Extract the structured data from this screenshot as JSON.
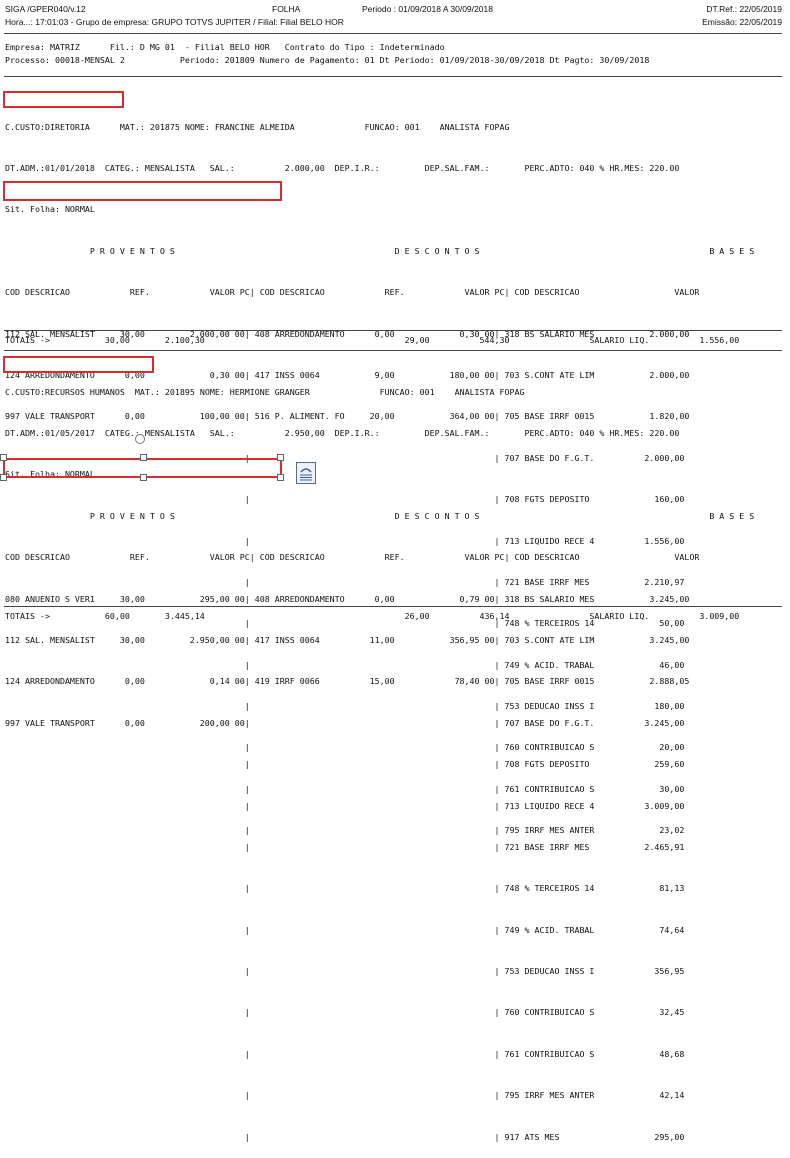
{
  "header": {
    "program": "SIGA /GPER040/v.12",
    "title": "FOLHA",
    "period": "Periodo : 01/09/2018 A 30/09/2018",
    "dt_ref": "DT.Ref.: 22/05/2019",
    "hora": "Hora...: 17:01:03 - Grupo de empresa: GRUPO TOTVS JUPITER / Filial: Filial BELO HOR",
    "emissao": "Emissão: 22/05/2019"
  },
  "company": {
    "line1": "Empresa: MATRIZ      Fil.: D MG 01  - Filial BELO HOR   Contrato do Tipo : Indeterminado",
    "line2": "Processo: 00018-MENSAL 2           Periodo: 201809 Numero de Pagamento: 01 Dt Periodo: 01/09/2018-30/09/2018 Dt Pagto: 30/09/2018"
  },
  "employees": [
    {
      "ccusto": "C.CUSTO:DIRETORIA",
      "info1": "MAT.: 201875 NOME: FRANCINE ALMEIDA              FUNCAO: 001    ANALISTA FOPAG",
      "info2": "DT.ADM.:01/01/2018  CATEG.: MENSALISTA   SAL.:          2.000,00  DEP.I.R.:         DEP.SAL.FAM.:       PERC.ADTO: 040 % HR.MES: 220.00",
      "info3": "Sit. Folha: NORMAL",
      "section_header": "                 P R O V E N T O S                                            D E S C O N T O S                                              B A S E S",
      "col_header": "COD DESCRICAO            REF.            VALOR PC| COD DESCRICAO            REF.            VALOR PC| COD DESCRICAO                   VALOR",
      "rows": [
        "112 SAL. MENSALIST     30,00         2.000,00 00| 408 ARREDONDAMENTO      0,00             0,30 00| 318 BS SALARIO MES           2.000,00",
        "124 ARREDONDAMENTO      0,00             0,30 00| 417 INSS 0064           9,00           180,00 00| 703 S.CONT ATE LIM           2.000,00",
        "997 VALE TRANSPORT      0,00           100,00 00| 516 P. ALIMENT. FO     20,00           364,00 00| 705 BASE IRRF 0015           1.820,00",
        "                                                |                                                 | 707 BASE DO F.G.T.          2.000,00",
        "                                                |                                                 | 708 FGTS DEPOSITO             160,00",
        "                                                |                                                 | 713 LIQUIDO RECE 4          1.556,00",
        "                                                |                                                 | 721 BASE IRRF MES           2.210,97",
        "                                                |                                                 | 748 % TERCEIROS 14             50,00",
        "                                                |                                                 | 749 % ACID. TRABAL             46,00",
        "                                                |                                                 | 753 DEDUCAO INSS I            180,00",
        "                                                |                                                 | 760 CONTRIBUICAO S             20,00",
        "                                                |                                                 | 761 CONTRIBUICAO S             30,00",
        "                                                |                                                 | 795 IRRF MES ANTER             23,02"
      ],
      "totals": "TOTAIS ->           30,00       2.100,30                                        29,00          544,30                SALARIO LIQ.          1.556,00"
    },
    {
      "ccusto": "C.CUSTO:RECURSOS HUMANOS",
      "info1": "MAT.: 201895 NOME: HERMIONE GRANGER              FUNCAO: 001    ANALISTA FOPAG",
      "info2": "DT.ADM.:01/05/2017  CATEG.: MENSALISTA   SAL.:          2.950,00  DEP.I.R.:         DEP.SAL.FAM.:       PERC.ADTO: 040 % HR.MES: 220.00",
      "info3": "Sit. Folha: NORMAL",
      "section_header": "                 P R O V E N T O S                                            D E S C O N T O S                                              B A S E S",
      "col_header": "COD DESCRICAO            REF.            VALOR PC| COD DESCRICAO            REF.            VALOR PC| COD DESCRICAO                   VALOR",
      "rows": [
        "080 ANUENIO S VER1     30,00           295,00 00| 408 ARREDONDAMENTO      0,00             0,79 00| 318 BS SALARIO MES           3.245,00",
        "112 SAL. MENSALIST     30,00         2.950,00 00| 417 INSS 0064          11,00           356,95 00| 703 S.CONT ATE LIM           3.245,00",
        "124 ARREDONDAMENTO      0,00             0,14 00| 419 IRRF 0066          15,00            78,40 00| 705 BASE IRRF 0015           2.888,05",
        "997 VALE TRANSPORT      0,00           200,00 00|                                                 | 707 BASE DO F.G.T.          3.245,00",
        "                                                |                                                 | 708 FGTS DEPOSITO             259,60",
        "                                                |                                                 | 713 LIQUIDO RECE 4          3.009,00",
        "                                                |                                                 | 721 BASE IRRF MES           2.465,91",
        "                                                |                                                 | 748 % TERCEIROS 14             81,13",
        "                                                |                                                 | 749 % ACID. TRABAL             74,64",
        "                                                |                                                 | 753 DEDUCAO INSS I            356,95",
        "                                                |                                                 | 760 CONTRIBUICAO S             32,45",
        "                                                |                                                 | 761 CONTRIBUICAO S             48,68",
        "                                                |                                                 | 795 IRRF MES ANTER             42,14",
        "                                                |                                                 | 917 ATS MES                   295,00"
      ],
      "totals": "TOTAIS ->           60,00       3.445,14                                        26,00          436,14                SALARIO LIQ.          3.009,00"
    }
  ],
  "colors": {
    "highlight": "#d92c2c",
    "rule": "#444444"
  },
  "icons": [
    "layout-options-icon"
  ]
}
